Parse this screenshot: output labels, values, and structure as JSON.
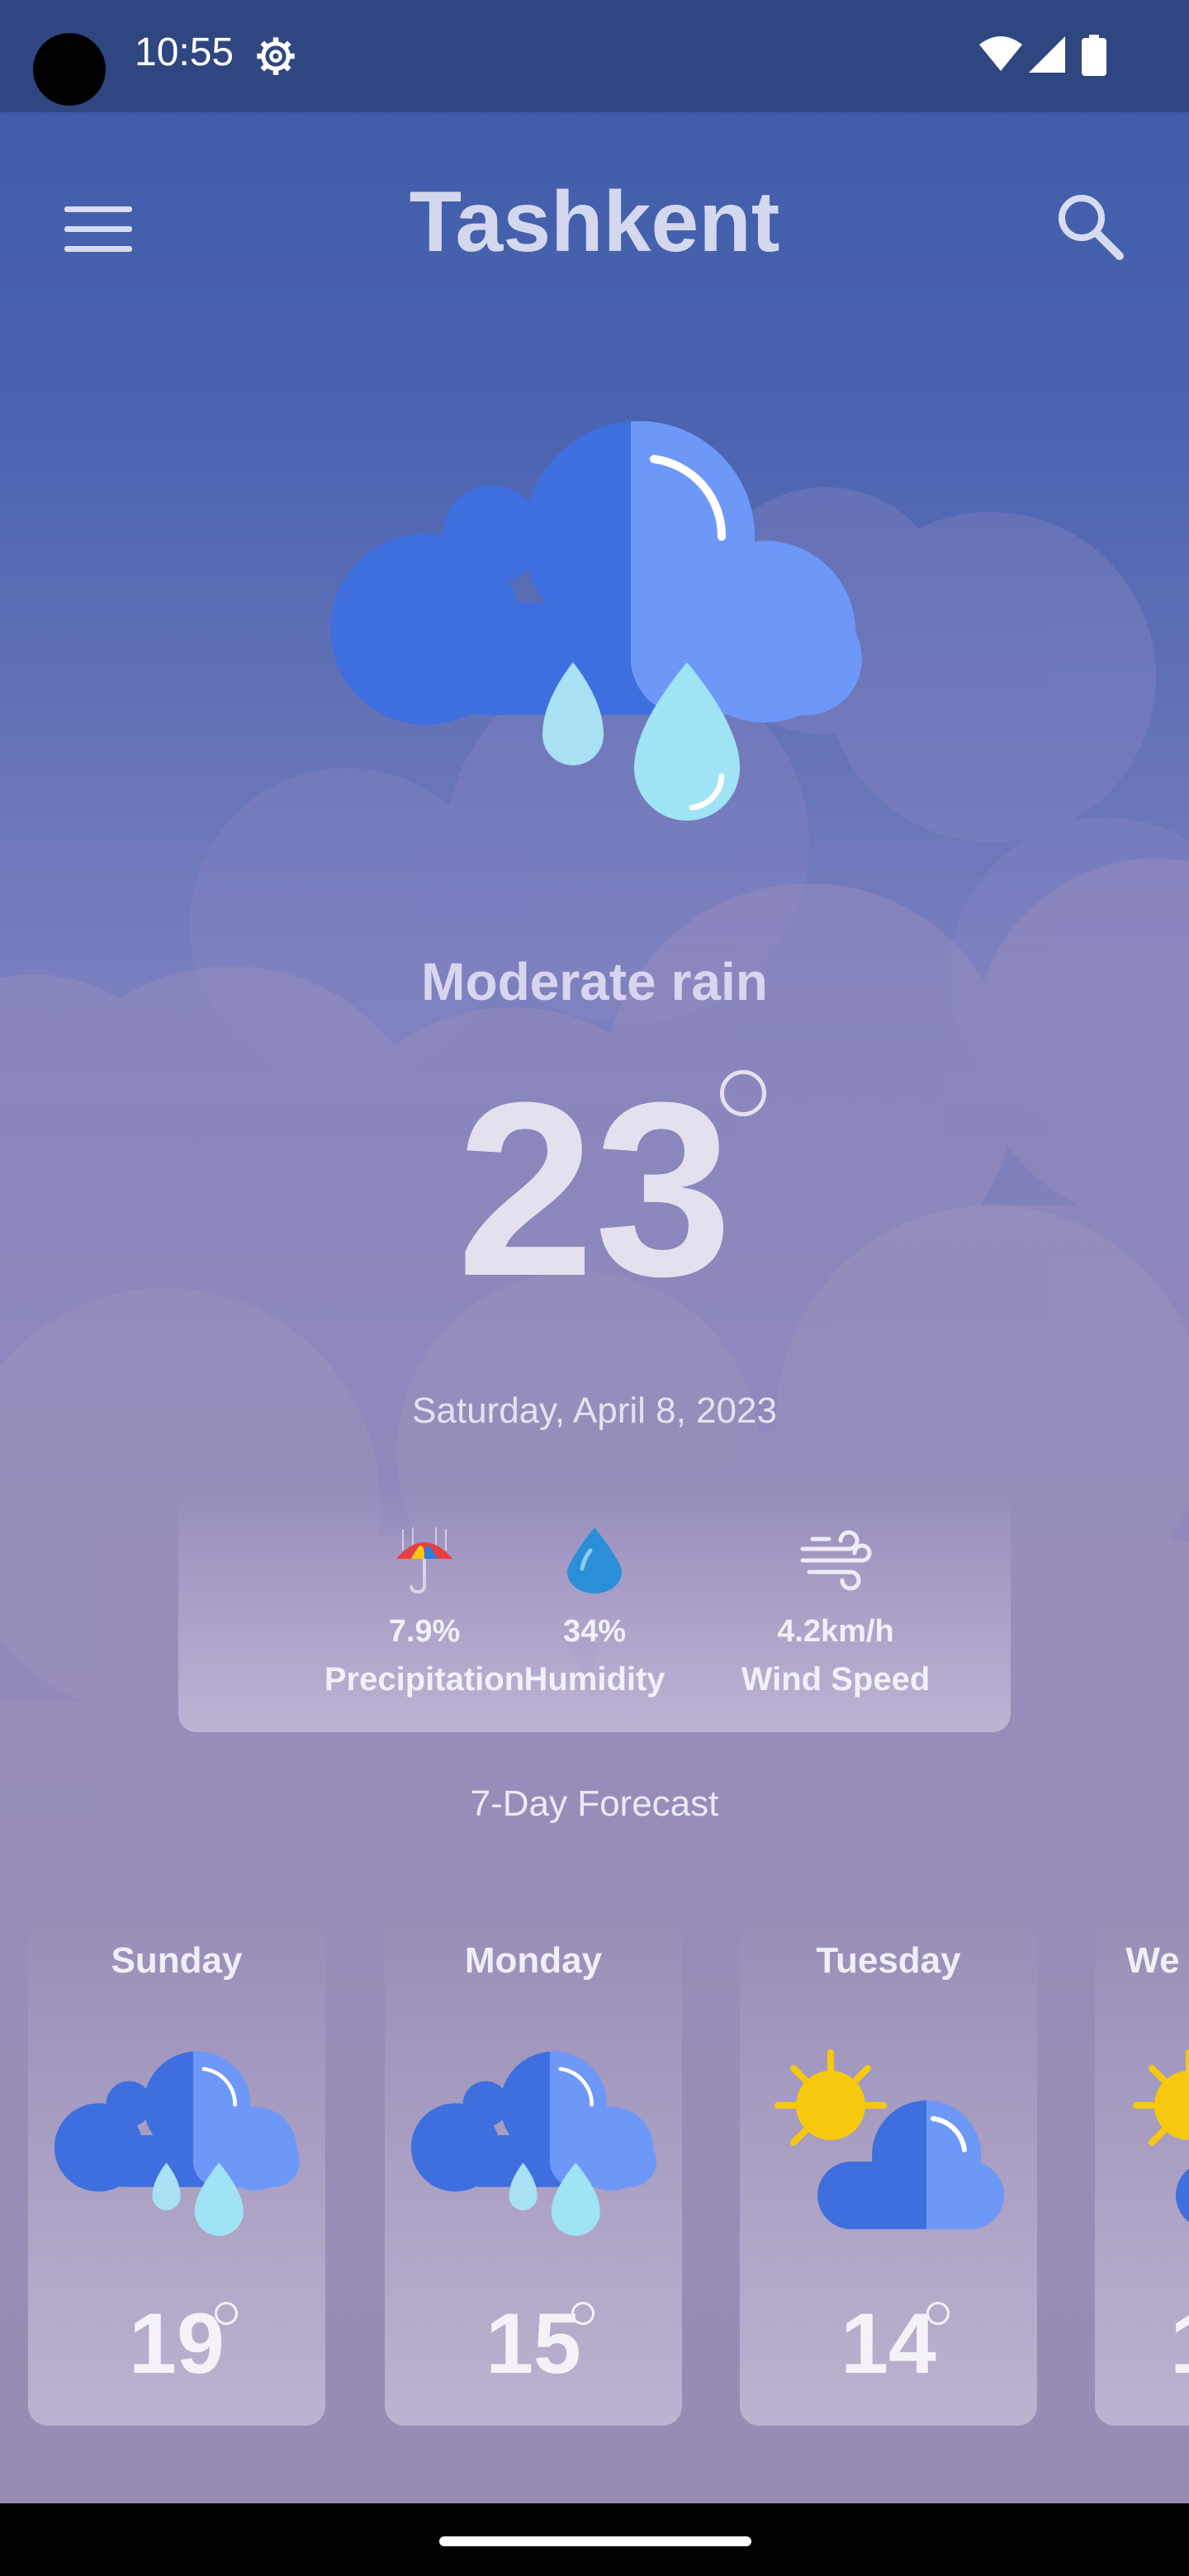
{
  "status_bar": {
    "time": "10:55"
  },
  "header": {
    "city": "Tashkent"
  },
  "current": {
    "condition": "Moderate rain",
    "temperature": "23",
    "date": "Saturday, April 8, 2023"
  },
  "stats": [
    {
      "value": "7.9%",
      "label": "Precipitation",
      "icon": "umbrella-icon"
    },
    {
      "value": "34%",
      "label": "Humidity",
      "icon": "water-drop-icon"
    },
    {
      "value": "4.2km/h",
      "label": "Wind Speed",
      "icon": "wind-icon"
    }
  ],
  "forecast": {
    "title": "7-Day Forecast",
    "days": [
      {
        "day": "Sunday",
        "temp": "19",
        "icon": "rain-cloud-icon"
      },
      {
        "day": "Monday",
        "temp": "15",
        "icon": "rain-cloud-icon"
      },
      {
        "day": "Tuesday",
        "temp": "14",
        "icon": "partly-cloudy-icon"
      },
      {
        "day": "We",
        "temp": "1",
        "icon": "partly-cloudy-icon"
      }
    ]
  },
  "colors": {
    "cloud_dark": "#3f6fdf",
    "cloud_light": "#6e98f8",
    "drop": "#9fe3f5",
    "sun": "#f6c90e"
  }
}
